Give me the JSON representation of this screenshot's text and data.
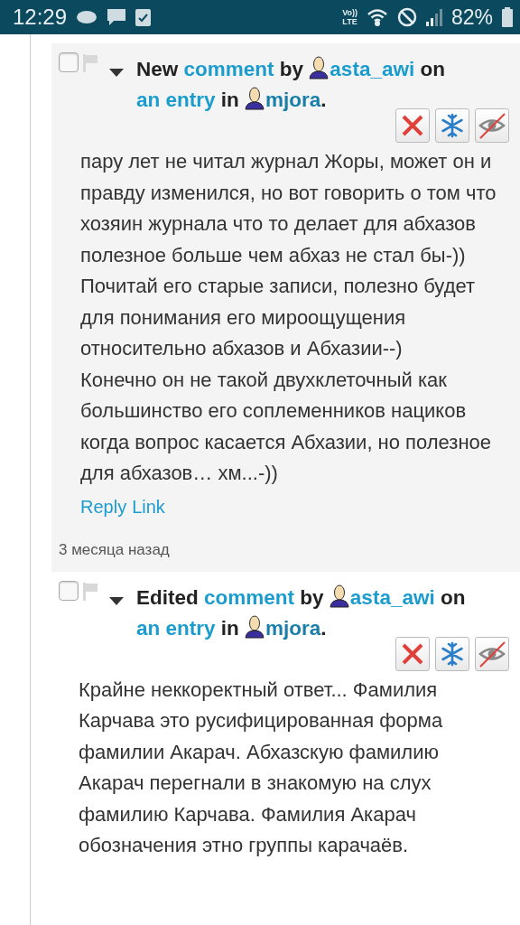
{
  "status_bar": {
    "time": "12:29",
    "volte_top": "Vo))",
    "volte_bottom": "LTE",
    "battery": "82%"
  },
  "comments": [
    {
      "checked": false,
      "action": "New",
      "link_comment": "comment",
      "by": "by",
      "author": "asta_awi",
      "on": "on",
      "link_entry": "an entry",
      "in": "in",
      "journal": "mjora",
      "end": ".",
      "body": [
        "пару лет не читал журнал Жоры, может он и правду изменился, но вот говорить о том что хозяин журнала что то делает для абхазов полезное больше чем абхаз не стал бы-)) Почитай его старые записи, полезно будет для понимания его мироощущения относительно абхазов и Абхазии--)",
        "Конечно он не такой двухклеточный как большинство его соплеменников нациков когда вопрос касается Абхазии, но полезное для абхазов… хм...-))"
      ],
      "reply": "Reply",
      "link": "Link",
      "time": "3 месяца назад",
      "shaded": true
    },
    {
      "checked": false,
      "action": "Edited",
      "link_comment": "comment",
      "by": "by",
      "author": "asta_awi",
      "on": "on",
      "link_entry": "an entry",
      "in": "in",
      "journal": "mjora",
      "end": ".",
      "body": [
        "Крайне неккоректный ответ... Фамилия Карчава это русифицированная форма фамилии Акарач. Абхазскую фамилию Акарач перегнали в знакомую на слух фамилию Карчава. Фамилия Акарач обозначения этно группы карачаёв."
      ],
      "shaded": false
    }
  ]
}
